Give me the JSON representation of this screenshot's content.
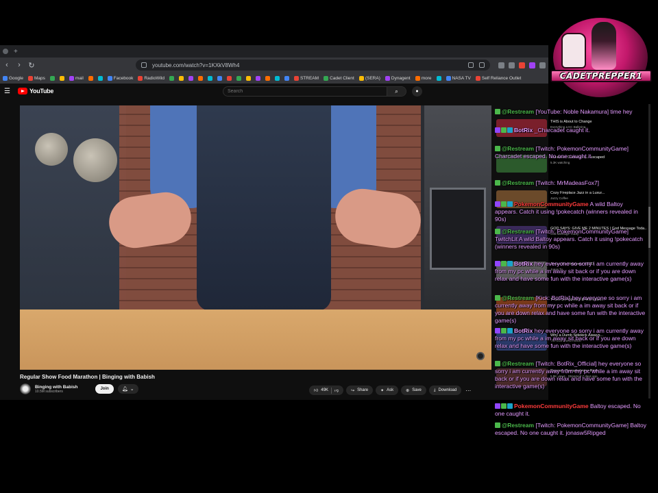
{
  "browser": {
    "url": "youtube.com/watch?v=1KXkV8Wh4",
    "bookmarks": [
      "Google",
      "Maps",
      "",
      "",
      "mail",
      "",
      "",
      "Facebook",
      "RadioWild",
      "",
      "",
      "",
      "",
      "",
      "",
      "",
      "",
      "",
      "",
      "",
      "",
      "",
      "STREAM",
      "Cadet Client",
      "(SERA)",
      "Dynagent",
      "more",
      "",
      "NASA TV",
      "Self Reliance Outlet"
    ]
  },
  "youtube": {
    "logo_text": "YouTube",
    "search_placeholder": "Search",
    "video": {
      "title": "Regular Show Food Marathon | Binging with Babish",
      "channel_name": "Binging with Babish",
      "subscribers": "10.5M subscribers",
      "join_label": "Join",
      "like_count": "49K",
      "share_label": "Share",
      "ask_label": "Ask",
      "save_label": "Save",
      "download_label": "Download"
    },
    "recommendations": [
      {
        "title": "THIS is About to Change",
        "meta": "Everything a KC Ballerina..."
      },
      {
        "title": "Pokemon Community... escaped",
        "meta": "5.3K watching"
      },
      {
        "title": "Cozy Fireplace Jazz in a Luxur...",
        "meta": "Jazzy Coffee"
      },
      {
        "title": "GOD SAYS: GIVE ME 2 MINUTES | God Message Toda...",
        "meta": "God Message Today"
      },
      {
        "title": "Jonas the Unknown LIVE!",
        "meta": "Jonas Tv"
      },
      {
        "title": "Truck GUNNA GIVE 400 miles...",
        "meta": "Live"
      },
      {
        "title": "Why a Dumb Sidekick Always...",
        "meta": "The Low Doesn't Exist"
      },
      {
        "title": "Danger: Overwhelming Pride",
        "meta": "5.9K views · Streamed 7 days ago"
      }
    ]
  },
  "overlay": {
    "streamer_name": "CADETPREPPER1"
  },
  "chat": [
    {
      "user": "@Restream",
      "text": "[YouTube: Noble Nakamura] time hey",
      "user_color": "#4bb84b"
    },
    {
      "user": "BotRix",
      "text": "_Charcadet caught it.",
      "user_color": "#e49bff"
    },
    {
      "user": "@Restream",
      "text": "[Twitch: PokemonCommunityGame] Charcadet escaped. No one caught it.",
      "user_color": "#4bb84b"
    },
    {
      "user": "",
      "text": "",
      "user_color": "#e49bff"
    },
    {
      "user": "@Restream",
      "text": "[Twitch: MrMadeasFox7]",
      "user_color": "#4bb84b"
    },
    {
      "user": "PokemonCommunityGame",
      "text": "A wild Baltoy appears. Catch it using !pokecatch (winners revealed in 90s)",
      "user_color": "#ff3b3b"
    },
    {
      "user": "@Restream",
      "text": "[Twitch: PokemonCommunityGame] TwitchLit A wild Baltoy appears. Catch it using !pokecatch (winners revealed in 90s)",
      "user_color": "#4bb84b"
    },
    {
      "user": "BotRix",
      "text": "hey everyone so sorry i am currently away from my pc while a im away sit back or if you are down relax and have some fun with the interactive game(s)",
      "user_color": "#e49bff"
    },
    {
      "user": "@Restream",
      "text": "[Kick: BotRix] hey everyone so sorry i am currently away from my pc while a im away sit back or if you are down relax and have some fun with the interactive game(s)",
      "user_color": "#4bb84b"
    },
    {
      "user": "BotRix",
      "text": "hey everyone so sorry i am currently away from my pc while a im away sit back or if you are down relax and have some fun with the interactive game(s)",
      "user_color": "#e49bff"
    },
    {
      "user": "@Restream",
      "text": "[Twitch: BotRix_Official] hey everyone so sorry i am currently away from my pc while a im away sit back or if you are down relax and have some fun with the interactive game(s)",
      "user_color": "#4bb84b"
    },
    {
      "user": "PokemonCommunityGame",
      "text": "Baltoy escaped. No one caught it.",
      "user_color": "#ff3b3b"
    },
    {
      "user": "@Restream",
      "text": "[Twitch: PokemonCommunityGame] Baltoy escaped. No one caught it. jonasw5Ripged",
      "user_color": "#4bb84b"
    }
  ],
  "colors": {
    "youtube_red": "#ff0000",
    "chat_text": "#e49bff",
    "restream_green": "#4bb84b",
    "pcg_red": "#ff3b3b",
    "overlay_pink": "#c2186b"
  },
  "icons": [
    "back-icon",
    "forward-icon",
    "reload-icon",
    "menu-icon",
    "search-icon",
    "mic-icon",
    "bell-icon",
    "like-icon",
    "dislike-icon",
    "share-icon",
    "ask-icon",
    "save-icon",
    "download-icon",
    "more-icon"
  ]
}
